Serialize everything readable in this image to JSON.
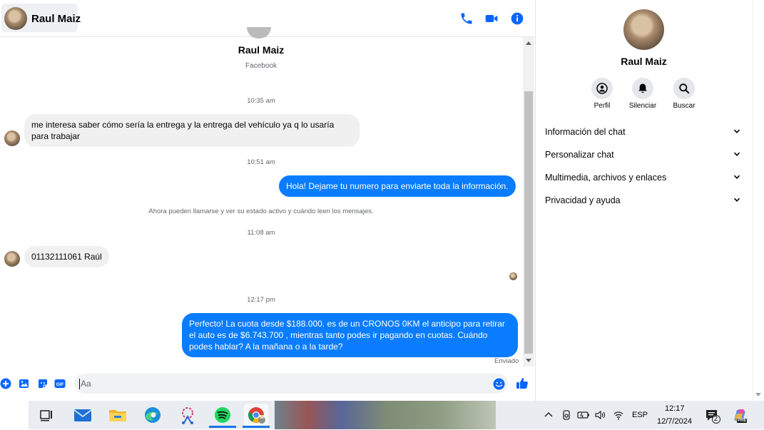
{
  "header": {
    "contact_name": "Raul Maiz"
  },
  "profile": {
    "name": "Raul Maiz",
    "source": "Facebook"
  },
  "messages": {
    "t1": "10:35 am",
    "m1": "me interesa saber cómo sería la entrega y la entrega del vehículo ya q lo usaría para trabajar",
    "t2": "10:51 am",
    "m2": "Hola! Dejame tu numero  para enviarte toda la información.",
    "notice": "Ahora pueden llamarse y ver su estado activo y cuándo leen los mensajes.",
    "t3": "11:08 am",
    "m3": "01132111061 Raúl",
    "t4": "12:17 pm",
    "m4": "Perfecto! La cuota desde $188.000. es de un CRONOS 0KM el anticipo para retirar el auto es de $6.743.700 , mientras tanto podes ir pagando en cuotas. Cuándo podes hablar? A la mañana o a la tarde?",
    "status": "Enviado"
  },
  "composer": {
    "placeholder": "Aa"
  },
  "right_panel": {
    "name": "Raul Maiz",
    "actions": [
      {
        "label": "Perfil",
        "icon": "profile-icon"
      },
      {
        "label": "Silenciar",
        "icon": "bell-icon"
      },
      {
        "label": "Buscar",
        "icon": "search-icon"
      }
    ],
    "sections": [
      "Información del chat",
      "Personalizar chat",
      "Multimedia, archivos y enlaces",
      "Privacidad y ayuda"
    ]
  },
  "taskbar": {
    "language": "ESP",
    "time": "12:17",
    "date": "12/7/2024",
    "notification_count": "2",
    "chrome_badge": "M",
    "copilot_badge": "PRE"
  },
  "colors": {
    "accent": "#0a7cff",
    "messenger_blue": "#0866ff"
  }
}
